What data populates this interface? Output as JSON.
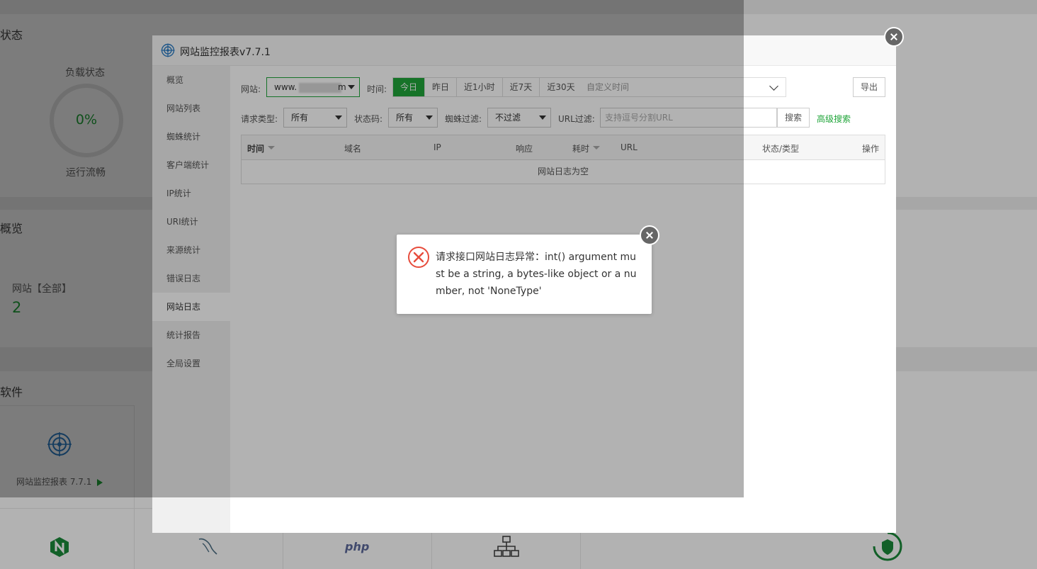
{
  "dashboard": {
    "status_title": "状态",
    "load_label": "负载状态",
    "load_value": "0%",
    "load_status": "运行流畅",
    "overview_title": "概览",
    "site_label": "网站【全部】",
    "site_count": "2",
    "software_title": "软件",
    "plugin_name": "网站监控报表 7.7.1",
    "php_label": "php"
  },
  "plugin": {
    "title": "网站监控报表v7.7.1",
    "sidebar": [
      {
        "label": "概览"
      },
      {
        "label": "网站列表"
      },
      {
        "label": "蜘蛛统计"
      },
      {
        "label": "客户端统计"
      },
      {
        "label": "IP统计"
      },
      {
        "label": "URI统计"
      },
      {
        "label": "来源统计"
      },
      {
        "label": "错误日志"
      },
      {
        "label": "网站日志",
        "active": true
      },
      {
        "label": "统计报告"
      },
      {
        "label": "全局设置"
      }
    ],
    "filters": {
      "site_label": "网站:",
      "site_value_prefix": "www.",
      "site_value_suffix": "m",
      "time_label": "时间:",
      "time_tabs": [
        "今日",
        "昨日",
        "近1小时",
        "近7天",
        "近30天"
      ],
      "time_custom": "自定义时间",
      "export_label": "导出",
      "request_type_label": "请求类型:",
      "request_type_value": "所有",
      "status_code_label": "状态码:",
      "status_code_value": "所有",
      "spider_filter_label": "蜘蛛过滤:",
      "spider_filter_value": "不过滤",
      "url_filter_label": "URL过滤:",
      "url_filter_placeholder": "支持逗号分割URL",
      "search_label": "搜索",
      "advanced_search_label": "高级搜索"
    },
    "table": {
      "columns": [
        "时间",
        "域名",
        "IP",
        "响应",
        "耗时",
        "URL",
        "状态/类型",
        "操作"
      ],
      "empty_text": "网站日志为空"
    }
  },
  "error_dialog": {
    "message": "请求接口网站日志异常：int() argument must be a string, a bytes-like object or a number, not 'NoneType'"
  },
  "colors": {
    "accent": "#20a53a",
    "error": "#e74c3c"
  }
}
